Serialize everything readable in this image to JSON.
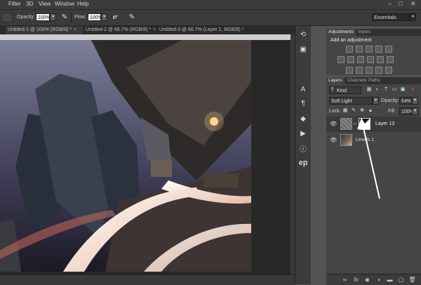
{
  "menu": {
    "items": [
      "Filter",
      "3D",
      "View",
      "Window",
      "Help"
    ]
  },
  "options": {
    "opacity_label": "Opacity:",
    "opacity_value": "100%",
    "flow_label": "Flow:",
    "flow_value": "100%",
    "workspace": "Essentials"
  },
  "tabs": [
    "Untitled-1 @ 100% (RGB/8) *",
    "Untitled-2 @ 66.7% (RGB/8) *",
    "Untitled-3 @ 66.7% (Layer 1, RGB/8) *"
  ],
  "adjustments": {
    "tabs": [
      "Adjustments",
      "Styles"
    ],
    "heading": "Add an adjustment"
  },
  "layers": {
    "tabs": [
      "Layers",
      "Channels",
      "Paths"
    ],
    "kind": "Kind",
    "blend_mode": "Soft Light",
    "opacity_label": "Opacity:",
    "opacity_value": "64%",
    "lock_label": "Lock:",
    "fill_label": "Fill:",
    "fill_value": "100%",
    "items": [
      {
        "name": "Layer 13"
      },
      {
        "name": "Levels 1"
      }
    ]
  },
  "icons": [
    "close-icon",
    "brush-tool-icon",
    "pressure-icon",
    "airbrush-icon",
    "history-icon",
    "actions-icon",
    "character-icon",
    "paragraph-icon",
    "3d-icon",
    "play-icon",
    "info-icon",
    "ep-icon",
    "eye-icon",
    "link-icon",
    "fx-icon",
    "mask-icon",
    "adjustment-icon",
    "folder-icon",
    "new-layer-icon",
    "trash-icon"
  ]
}
